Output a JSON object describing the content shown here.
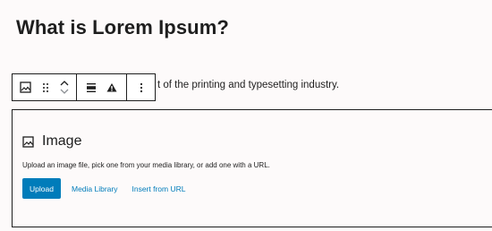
{
  "heading": "What is Lorem Ipsum?",
  "paragraph": "t of the printing and typesetting industry.",
  "toolbar": {
    "buttons": [
      {
        "icon": "image-icon",
        "label": "Image"
      },
      {
        "icon": "drag-handle-icon",
        "label": "Drag"
      },
      {
        "icon": "chevron-up-icon",
        "label": "Move up"
      },
      {
        "icon": "chevron-down-icon",
        "label": "Move down"
      },
      {
        "icon": "align-icon",
        "label": "Change alignment"
      },
      {
        "icon": "warning-icon",
        "label": "Warning"
      },
      {
        "icon": "more-options-icon",
        "label": "Options"
      }
    ]
  },
  "image_block": {
    "title": "Image",
    "instructions": "Upload an image file, pick one from your media library, or add one with a URL.",
    "upload_label": "Upload",
    "media_library_label": "Media Library",
    "insert_url_label": "Insert from URL"
  },
  "colors": {
    "accent": "#007cba",
    "text": "#1e1e1e",
    "background": "#fdfafa"
  }
}
